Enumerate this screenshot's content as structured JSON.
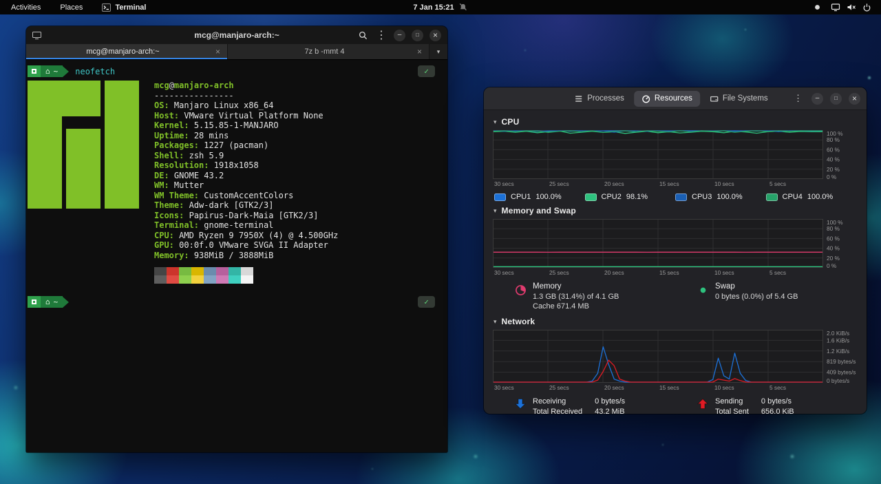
{
  "theme": {
    "green": "#80c028",
    "cyan": "#3fc6c6",
    "accent": "#3584e4",
    "seg1": "#2fa14c",
    "seg2": "#1f7a3a",
    "check": "#5fd97a",
    "memory": "#e03b6e",
    "swap": "#2ec27e",
    "receive": "#1c71d8",
    "send": "#e01b24"
  },
  "glyphs": {
    "minimize": "–",
    "maximize": "□",
    "close": "×",
    "kebab": "⋮",
    "dropdown": "▾",
    "tri": "▾",
    "check": "✓",
    "home": "⌂",
    "tab_close": "×"
  },
  "top_bar": {
    "activities": "Activities",
    "places": "Places",
    "terminal": "Terminal",
    "clock": "7 Jan 15:21"
  },
  "terminal": {
    "title": "mcg@manjaro-arch:~",
    "tabs": [
      {
        "label": "mcg@manjaro-arch:~"
      },
      {
        "label": "7z b -mmt 4"
      }
    ],
    "prompt": {
      "path": "~",
      "command": "neofetch"
    },
    "neofetch": {
      "user": "mcg",
      "at": "@",
      "host": "manjaro-arch",
      "separator": "----------------",
      "info": [
        {
          "label": "OS:",
          "value": "Manjaro Linux x86_64"
        },
        {
          "label": "Host:",
          "value": "VMware Virtual Platform None"
        },
        {
          "label": "Kernel:",
          "value": "5.15.85-1-MANJARO"
        },
        {
          "label": "Uptime:",
          "value": "28 mins"
        },
        {
          "label": "Packages:",
          "value": "1227 (pacman)"
        },
        {
          "label": "Shell:",
          "value": "zsh 5.9"
        },
        {
          "label": "Resolution:",
          "value": "1918x1058"
        },
        {
          "label": "DE:",
          "value": "GNOME 43.2"
        },
        {
          "label": "WM:",
          "value": "Mutter"
        },
        {
          "label": "WM Theme:",
          "value": "CustomAccentColors"
        },
        {
          "label": "Theme:",
          "value": "Adw-dark [GTK2/3]"
        },
        {
          "label": "Icons:",
          "value": "Papirus-Dark-Maia [GTK2/3]"
        },
        {
          "label": "Terminal:",
          "value": "gnome-terminal"
        },
        {
          "label": "CPU:",
          "value": "AMD Ryzen 9 7950X (4) @ 4.500GHz"
        },
        {
          "label": "GPU:",
          "value": "00:0f.0 VMware SVGA II Adapter"
        },
        {
          "label": "Memory:",
          "value": "938MiB / 3888MiB"
        }
      ],
      "palette": [
        "#454545",
        "#cc342b",
        "#77bb41",
        "#d9b600",
        "#6a8cad",
        "#b7609d",
        "#33b5a6",
        "#d8d8d8",
        "#5e5e5e",
        "#e04b43",
        "#8ed04e",
        "#f2d13d",
        "#82a4c4",
        "#cf7ab5",
        "#3fd0c0",
        "#f4f4f4"
      ]
    }
  },
  "system_monitor": {
    "tabs": [
      {
        "label": "Processes"
      },
      {
        "label": "Resources"
      },
      {
        "label": "File Systems"
      }
    ],
    "sections": {
      "cpu": "CPU",
      "memory": "Memory and Swap",
      "network": "Network"
    },
    "cpu_legend": [
      {
        "name": "CPU1",
        "value": "100.0%"
      },
      {
        "name": "CPU2",
        "value": "98.1%"
      },
      {
        "name": "CPU3",
        "value": "100.0%"
      },
      {
        "name": "CPU4",
        "value": "100.0%"
      }
    ],
    "memory_legend": {
      "memory_title": "Memory",
      "memory_line1": "1.3 GB (31.4%) of 4.1 GB",
      "memory_line2": "Cache 671.4 MB",
      "swap_title": "Swap",
      "swap_line1": "0 bytes (0.0%) of 5.4 GB"
    },
    "network_legend": {
      "receiving_label": "Receiving",
      "receiving_value": "0 bytes/s",
      "total_received_label": "Total Received",
      "total_received_value": "43.2 MiB",
      "sending_label": "Sending",
      "sending_value": "0 bytes/s",
      "total_sent_label": "Total Sent",
      "total_sent_value": "656.0 KiB"
    }
  },
  "chart_data": [
    {
      "type": "line",
      "title": "CPU",
      "ymax": 100,
      "x_ticks": [
        "30 secs",
        "25 secs",
        "20 secs",
        "15 secs",
        "10 secs",
        "5 secs"
      ],
      "y_ticks": [
        "100 %",
        "80 %",
        "60 %",
        "40 %",
        "20 %",
        "0 %"
      ],
      "series": [
        {
          "name": "CPU1",
          "color": "#1c71d8",
          "values": [
            100,
            100,
            99.5,
            100,
            100,
            98.5,
            100,
            100,
            100,
            99,
            100,
            100,
            100,
            97.5,
            100,
            100,
            99,
            100,
            100,
            100,
            98,
            100,
            100,
            100,
            99.5,
            100,
            100,
            100,
            100,
            100,
            100
          ]
        },
        {
          "name": "CPU2",
          "color": "#2ec27e",
          "values": [
            98,
            99,
            97,
            99,
            96,
            98,
            99.5,
            95,
            97,
            99,
            96.5,
            98,
            94.5,
            97,
            99,
            96,
            98,
            95.5,
            97,
            99,
            98,
            96,
            99,
            97.5,
            95,
            98,
            99,
            97,
            98.5,
            98,
            98.1
          ]
        },
        {
          "name": "CPU3",
          "color": "#1a5fb4",
          "values": [
            100,
            99,
            100,
            100,
            98.5,
            100,
            100,
            99,
            100,
            100,
            100,
            97,
            100,
            100,
            99,
            100,
            100,
            100,
            98,
            100,
            100,
            100,
            99,
            100,
            100,
            100,
            98,
            100,
            100,
            99.5,
            100
          ]
        },
        {
          "name": "CPU4",
          "color": "#26a269",
          "values": [
            99,
            100,
            98,
            100,
            99.5,
            96.5,
            99,
            100,
            98,
            100,
            97,
            99,
            100,
            98,
            100,
            99,
            97.5,
            100,
            98,
            100,
            99,
            100,
            97,
            99,
            100,
            98.5,
            100,
            99,
            100,
            100,
            100
          ]
        }
      ]
    },
    {
      "type": "line",
      "title": "Memory and Swap",
      "ymax": 100,
      "x_ticks": [
        "30 secs",
        "25 secs",
        "20 secs",
        "15 secs",
        "10 secs",
        "5 secs"
      ],
      "y_ticks": [
        "100 %",
        "80 %",
        "60 %",
        "40 %",
        "20 %",
        "0 %"
      ],
      "series": [
        {
          "name": "Memory",
          "color": "#e03b6e",
          "values": [
            31.4,
            31.4,
            31.5,
            31.4,
            31.4,
            31.3,
            31.4,
            31.4,
            31.4,
            31.5,
            31.4,
            31.4,
            31.4,
            31.4,
            31.3,
            31.4,
            31.4,
            31.5,
            31.4,
            31.4,
            31.4,
            31.4,
            31.4,
            31.3,
            31.4,
            31.4,
            31.4,
            31.5,
            31.4,
            31.4,
            31.4
          ]
        },
        {
          "name": "Swap",
          "color": "#2ec27e",
          "values": [
            1,
            1,
            1,
            1,
            1,
            1,
            1,
            1,
            1,
            1,
            1,
            1,
            1,
            1,
            1,
            1,
            1,
            1,
            1,
            1,
            1,
            1,
            1,
            1,
            1,
            1,
            1,
            1,
            1,
            1,
            1
          ]
        }
      ]
    },
    {
      "type": "line",
      "title": "Network",
      "ymax": 2048,
      "x_ticks": [
        "30 secs",
        "25 secs",
        "20 secs",
        "15 secs",
        "10 secs",
        "5 secs"
      ],
      "y_ticks": [
        "2.0 KiB/s",
        "1.6 KiB/s",
        "1.2 KiB/s",
        "819 bytes/s",
        "409 bytes/s",
        "0 bytes/s"
      ],
      "series": [
        {
          "name": "Receiving",
          "color": "#1c71d8",
          "values": [
            0,
            0,
            0,
            0,
            0,
            0,
            0,
            0,
            0,
            0,
            0,
            0,
            0,
            0,
            0,
            0,
            0,
            0,
            40,
            350,
            1400,
            700,
            120,
            40,
            0,
            0,
            0,
            0,
            0,
            0,
            0,
            0,
            0,
            0,
            0,
            0,
            0,
            0,
            0,
            0,
            100,
            950,
            250,
            120,
            1150,
            350,
            60,
            0,
            0,
            0,
            0,
            0,
            0,
            0,
            0,
            0,
            0,
            0,
            0,
            0,
            0
          ]
        },
        {
          "name": "Sending",
          "color": "#e01b24",
          "values": [
            0,
            0,
            0,
            0,
            0,
            0,
            0,
            0,
            0,
            0,
            0,
            0,
            0,
            0,
            0,
            0,
            0,
            0,
            0,
            80,
            420,
            870,
            650,
            120,
            40,
            0,
            0,
            0,
            0,
            0,
            0,
            0,
            0,
            0,
            0,
            0,
            0,
            0,
            0,
            0,
            0,
            120,
            80,
            40,
            140,
            60,
            0,
            0,
            0,
            0,
            0,
            0,
            0,
            0,
            0,
            0,
            0,
            0,
            0,
            0,
            0
          ]
        }
      ]
    }
  ]
}
